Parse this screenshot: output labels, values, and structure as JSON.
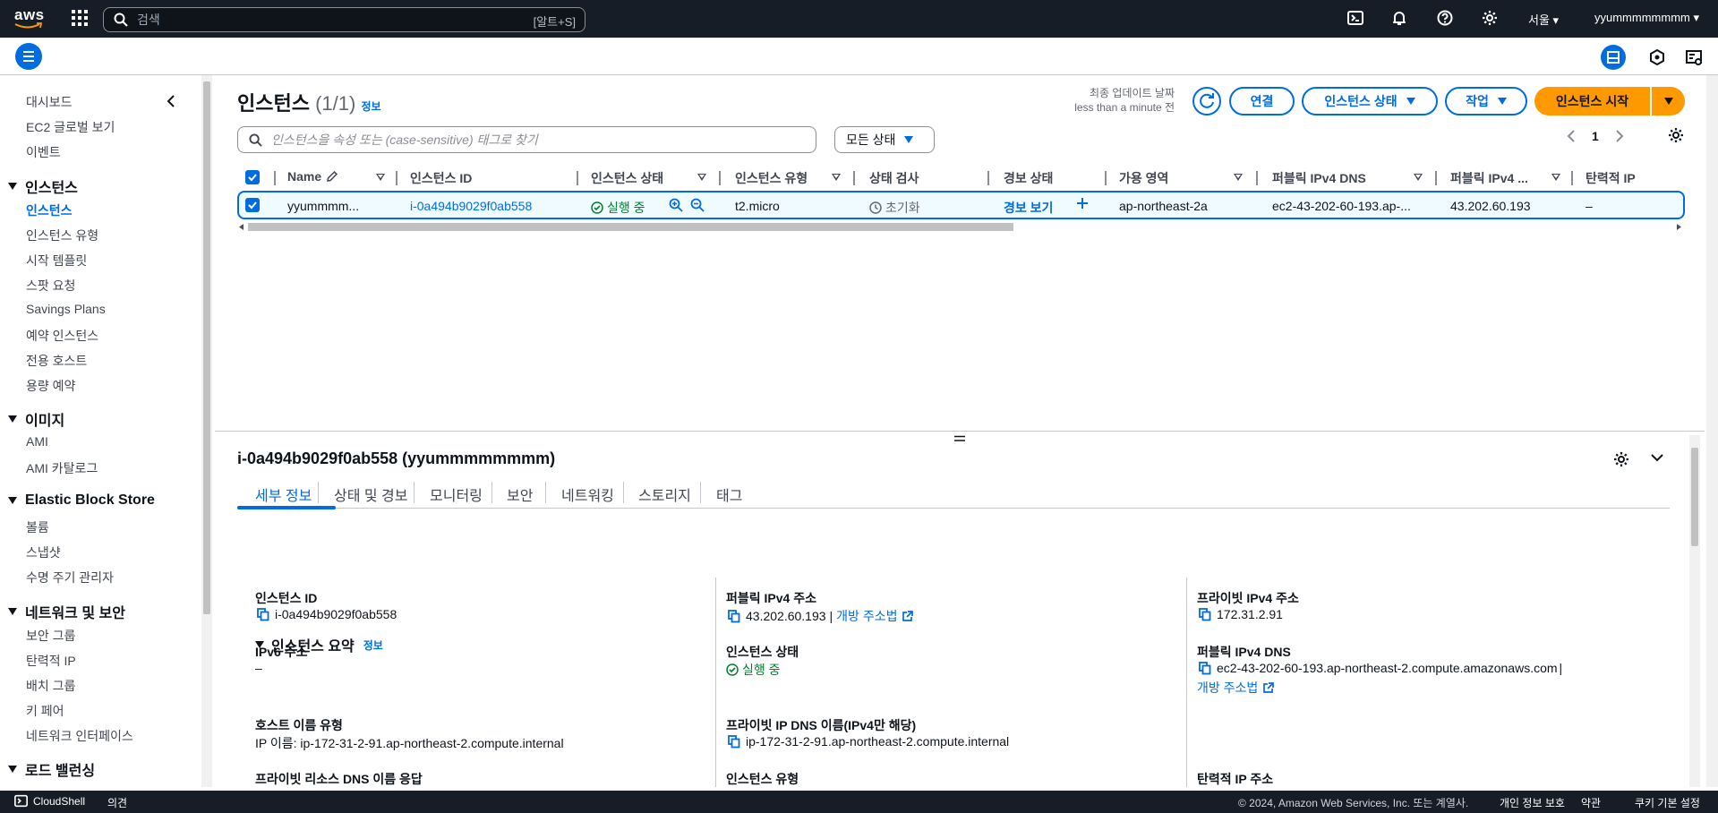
{
  "topnav": {
    "logo": "aws",
    "search_placeholder": "검색",
    "search_shortcut": "[알트+S]",
    "region": "서울",
    "account": "yyummmmmmmm",
    "icons": [
      "services-grid-icon",
      "cloudshell-icon",
      "bell-icon",
      "help-icon",
      "settings-icon"
    ]
  },
  "sidebar": {
    "top_items": [
      "대시보드",
      "EC2 글로벌 보기",
      "이벤트"
    ],
    "sections": [
      {
        "title": "인스턴스",
        "items": [
          "인스턴스",
          "인스턴스 유형",
          "시작 템플릿",
          "스팟 요청",
          "Savings Plans",
          "예약 인스턴스",
          "전용 호스트",
          "용량 예약"
        ]
      },
      {
        "title": "이미지",
        "items": [
          "AMI",
          "AMI 카탈로그"
        ]
      },
      {
        "title": "Elastic Block Store",
        "items": [
          "볼륨",
          "스냅샷",
          "수명 주기 관리자"
        ]
      },
      {
        "title": "네트워크 및 보안",
        "items": [
          "보안 그룹",
          "탄력적 IP",
          "배치 그룹",
          "키 페어",
          "네트워크 인터페이스"
        ]
      },
      {
        "title": "로드 밸런싱",
        "items": []
      }
    ],
    "active_item": "인스턴스"
  },
  "main": {
    "title": "인스턴스",
    "count": "(1/1)",
    "info": "정보",
    "last_update_label": "최종 업데이트 날짜",
    "last_update_value": "less than a minute 전",
    "buttons": {
      "connect": "연결",
      "instance_state": "인스턴스 상태",
      "actions": "작업",
      "launch": "인스턴스 시작"
    },
    "filter_placeholder": "인스턴스을 속성 또는 (case-sensitive) 태그로 찾기",
    "state_filter": "모든 상태",
    "page": "1",
    "table": {
      "headers": [
        "Name",
        "인스턴스 ID",
        "인스턴스 상태",
        "인스턴스 유형",
        "상태 검사",
        "경보 상태",
        "가용 영역",
        "퍼블릭 IPv4 DNS",
        "퍼블릭 IPv4 ...",
        "탄력적 IP"
      ],
      "row": {
        "name": "yyummmm...",
        "id": "i-0a494b9029f0ab558",
        "state": "실행 중",
        "type": "t2.micro",
        "check": "초기화",
        "alarm": "경보 보기",
        "az": "ap-northeast-2a",
        "dns": "ec2-43-202-60-193.ap-...",
        "ipv4": "43.202.60.193",
        "eip": "–"
      }
    }
  },
  "detail": {
    "title": "i-0a494b9029f0ab558 (yyummmmmmmm)",
    "tabs": [
      "세부 정보",
      "상태 및 경보",
      "모니터링",
      "보안",
      "네트워킹",
      "스토리지",
      "태그"
    ],
    "summary_title": "인스턴스 요약",
    "summary_info": "정보",
    "fields": {
      "instance_id_label": "인스턴스 ID",
      "instance_id": "i-0a494b9029f0ab558",
      "ipv6_label": "IPv6 주소",
      "ipv6": "–",
      "hostname_type_label": "호스트 이름 유형",
      "hostname_type": "IP 이름: ip-172-31-2-91.ap-northeast-2.compute.internal",
      "private_dns_answer_label": "프라이빗 리소스 DNS 이름 응답",
      "public_ipv4_label": "퍼블릭 IPv4 주소",
      "public_ipv4": "43.202.60.193",
      "open_address": "개방 주소법",
      "state_label": "인스턴스 상태",
      "state": "실행 중",
      "private_dns_label": "프라이빗 IP DNS 이름(IPv4만 해당)",
      "private_dns": "ip-172-31-2-91.ap-northeast-2.compute.internal",
      "instance_type_label": "인스턴스 유형",
      "private_ipv4_label": "프라이빗 IPv4 주소",
      "private_ipv4": "172.31.2.91",
      "public_dns_label": "퍼블릭 IPv4 DNS",
      "public_dns": "ec2-43-202-60-193.ap-northeast-2.compute.amazonaws.com",
      "public_dns_open": "개방 주소법",
      "eip_label": "탄력적 IP 주소"
    }
  },
  "footer": {
    "cloudshell": "CloudShell",
    "feedback": "의견",
    "copyright": "© 2024, Amazon Web Services, Inc. 또는 계열사.",
    "privacy": "개인 정보 보호",
    "terms": "약관",
    "cookies": "쿠키 기본 설정"
  },
  "colors": {
    "nav_bg": "#161d26",
    "accent": "#006ce0",
    "primary_button": "#ff9900",
    "success": "#00802f"
  }
}
